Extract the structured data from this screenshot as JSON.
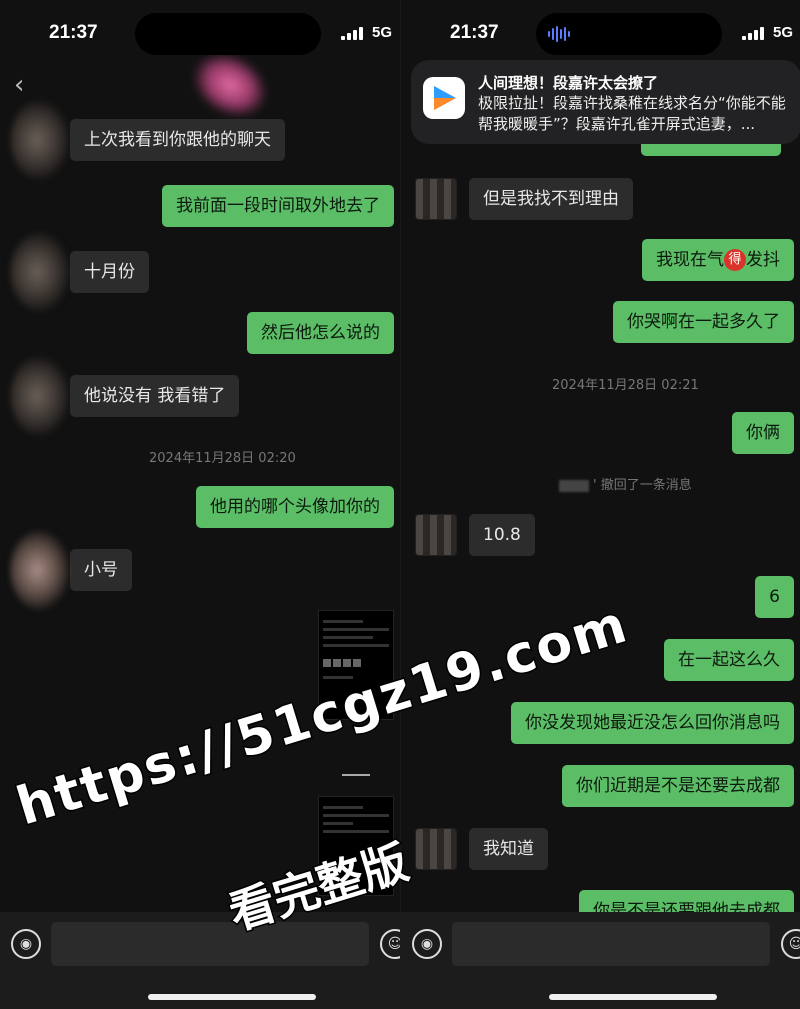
{
  "status": {
    "time": "21:37",
    "network": "5G"
  },
  "left": {
    "messages": [
      {
        "side": "in",
        "text": "上次我看到你跟他的聊天"
      },
      {
        "side": "out",
        "text": "我前面一段时间取外地去了"
      },
      {
        "side": "in",
        "text": "十月份"
      },
      {
        "side": "out",
        "text": "然后他怎么说的"
      },
      {
        "side": "in",
        "text": "他说没有 我看错了"
      },
      {
        "side": "out",
        "text": "他用的哪个头像加你的"
      },
      {
        "side": "in",
        "text": "小号"
      }
    ],
    "timestamp": "2024年11月28日 02:20"
  },
  "right": {
    "notification": {
      "title": "人间理想！段嘉许太会撩了",
      "body": "极限拉扯！段嘉许找桑稚在线求名分“你能不能帮我暖暖手”？段嘉许孔雀开屏式追妻，..."
    },
    "messages": [
      {
        "side": "in",
        "text": "但是我找不到理由"
      },
      {
        "side": "out",
        "text_before": "我现在气",
        "emoji_char": "得",
        "text_after": "发抖"
      },
      {
        "side": "out",
        "text": "你哭啊在一起多久了"
      },
      {
        "side": "out",
        "text": "你俩"
      },
      {
        "side": "in",
        "text": "10.8"
      },
      {
        "side": "out",
        "text": "6"
      },
      {
        "side": "out",
        "text": "在一起这么久"
      },
      {
        "side": "out",
        "text": "你没发现她最近没怎么回你消息吗"
      },
      {
        "side": "out",
        "text": "你们近期是不是还要去成都"
      },
      {
        "side": "in",
        "text": "我知道"
      },
      {
        "side": "out",
        "text": "你是不是还要跟他去成都"
      }
    ],
    "timestamp": "2024年11月28日 02:21",
    "recall_text": "' 撤回了一条消息"
  },
  "watermark": {
    "url": "https://51cgz19.com",
    "text": "看完整版"
  },
  "icons": {
    "voice": "voice-icon",
    "emoji": "emoji-icon",
    "back": "back-icon",
    "app": "video-app-icon"
  }
}
